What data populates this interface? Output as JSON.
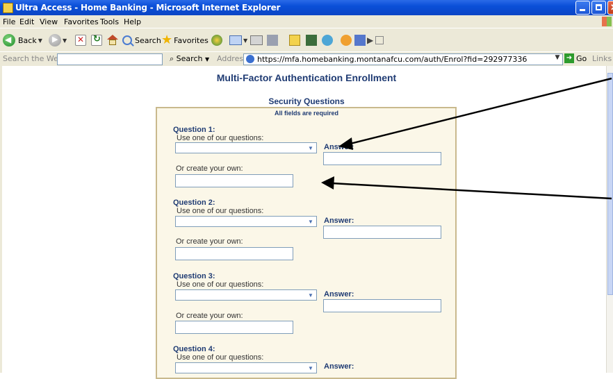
{
  "window": {
    "title": "Ultra Access - Home Banking - Microsoft Internet Explorer"
  },
  "menu": {
    "items": [
      "File",
      "Edit",
      "View",
      "Favorites",
      "Tools",
      "Help"
    ]
  },
  "toolbar": {
    "back_label": "Back",
    "search_label": "Search",
    "favorites_label": "Favorites"
  },
  "addressbar": {
    "search_web_label": "Search the Web",
    "search_button": "Search",
    "address_label": "Address",
    "url": "https://mfa.homebanking.montanafcu.com/auth/Enrol?fid=292977336",
    "go_label": "Go",
    "links_label": "Links"
  },
  "page": {
    "title": "Multi-Factor Authentication Enrollment",
    "section_title": "Security Questions",
    "required_note": "All fields are required"
  },
  "questions": [
    {
      "label": "Question 1:",
      "select_hint": "Use one of our questions:",
      "answer_label": "Answer:",
      "custom_hint": "Or create your own:"
    },
    {
      "label": "Question 2:",
      "select_hint": "Use one of our questions:",
      "answer_label": "Answer:",
      "custom_hint": "Or create your own:"
    },
    {
      "label": "Question 3:",
      "select_hint": "Use one of our questions:",
      "answer_label": "Answer:",
      "custom_hint": "Or create your own:"
    },
    {
      "label": "Question 4:",
      "select_hint": "Use one of our questions:",
      "answer_label": "Answer:"
    }
  ]
}
